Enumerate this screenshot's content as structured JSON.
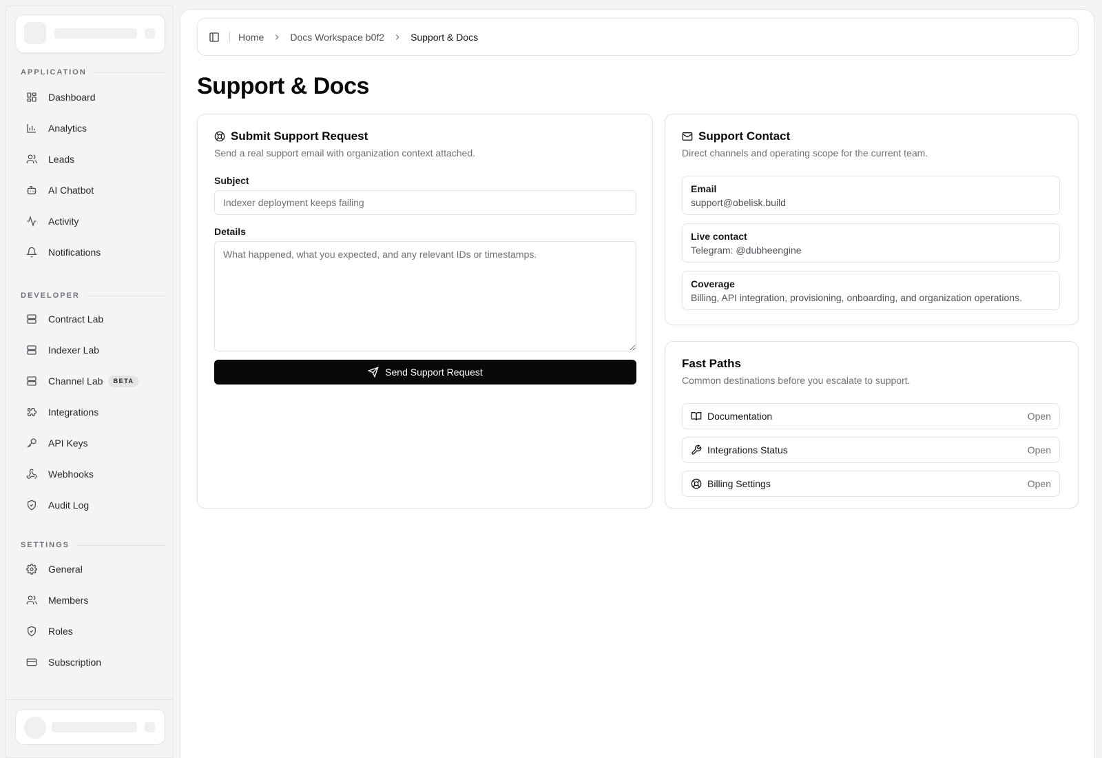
{
  "sidebar": {
    "sections": [
      {
        "label": "Application"
      },
      {
        "label": "Developer"
      },
      {
        "label": "Settings"
      }
    ],
    "items": [
      {
        "label": "Dashboard",
        "icon": "dashboard-icon"
      },
      {
        "label": "Analytics",
        "icon": "bar-chart-icon"
      },
      {
        "label": "Leads",
        "icon": "users-icon"
      },
      {
        "label": "AI Chatbot",
        "icon": "bot-icon"
      },
      {
        "label": "Activity",
        "icon": "activity-icon"
      },
      {
        "label": "Notifications",
        "icon": "bell-icon"
      },
      {
        "label": "Contract Lab",
        "icon": "server-icon"
      },
      {
        "label": "Indexer Lab",
        "icon": "server-icon"
      },
      {
        "label": "Channel Lab",
        "icon": "server-icon",
        "badge": "BETA"
      },
      {
        "label": "Integrations",
        "icon": "puzzle-icon"
      },
      {
        "label": "API Keys",
        "icon": "key-icon"
      },
      {
        "label": "Webhooks",
        "icon": "webhook-icon"
      },
      {
        "label": "Audit Log",
        "icon": "shield-check-icon"
      },
      {
        "label": "General",
        "icon": "gear-icon"
      },
      {
        "label": "Members",
        "icon": "users-icon"
      },
      {
        "label": "Roles",
        "icon": "shield-icon"
      },
      {
        "label": "Subscription",
        "icon": "credit-card-icon"
      }
    ]
  },
  "breadcrumb": {
    "items": [
      "Home",
      "Docs Workspace b0f2",
      "Support & Docs"
    ]
  },
  "page": {
    "title": "Support & Docs"
  },
  "support_request": {
    "title": "Submit Support Request",
    "description": "Send a real support email with organization context attached.",
    "subject_label": "Subject",
    "subject_placeholder": "Indexer deployment keeps failing",
    "details_label": "Details",
    "details_placeholder": "What happened, what you expected, and any relevant IDs or timestamps.",
    "submit_label": "Send Support Request"
  },
  "support_contact": {
    "title": "Support Contact",
    "description": "Direct channels and operating scope for the current team.",
    "entries": [
      {
        "key": "Email",
        "value": "support@obelisk.build"
      },
      {
        "key": "Live contact",
        "value": "Telegram: @dubheengine"
      },
      {
        "key": "Coverage",
        "value": "Billing, API integration, provisioning, onboarding, and organization operations."
      }
    ]
  },
  "fast_paths": {
    "title": "Fast Paths",
    "description": "Common destinations before you escalate to support.",
    "items": [
      {
        "label": "Documentation",
        "action": "Open",
        "icon": "book-open-icon"
      },
      {
        "label": "Integrations Status",
        "action": "Open",
        "icon": "wrench-icon"
      },
      {
        "label": "Billing Settings",
        "action": "Open",
        "icon": "life-buoy-icon"
      }
    ]
  }
}
